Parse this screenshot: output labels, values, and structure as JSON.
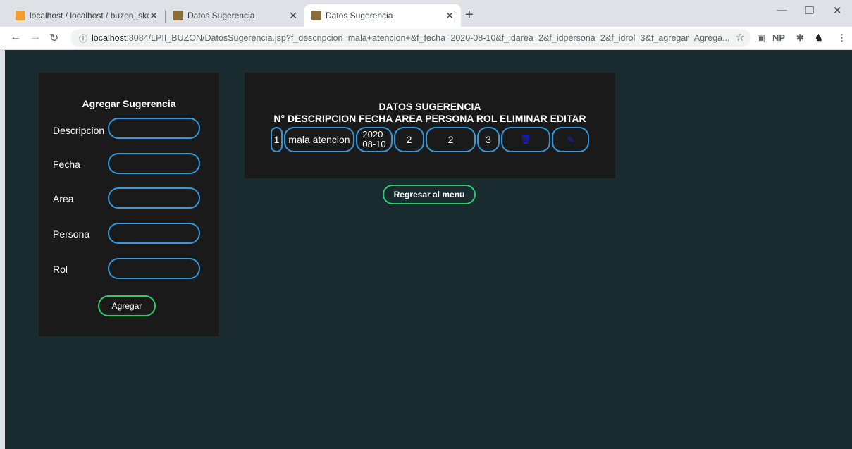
{
  "browser": {
    "tabs": [
      {
        "title": "localhost / localhost / buzon_ske",
        "active": false
      },
      {
        "title": "Datos Sugerencia",
        "active": false
      },
      {
        "title": "Datos Sugerencia",
        "active": true
      }
    ],
    "url_host": "localhost",
    "url_rest": ":8084/LPII_BUZON/DatosSugerencia.jsp?f_descripcion=mala+atencion+&f_fecha=2020-08-10&f_idarea=2&f_idpersona=2&f_idrol=3&f_agregar=Agrega...",
    "ext_np": "NP"
  },
  "form": {
    "title": "Agregar Sugerencia",
    "fields": [
      {
        "label": "Descripcion",
        "value": ""
      },
      {
        "label": "Fecha",
        "value": ""
      },
      {
        "label": "Area",
        "value": ""
      },
      {
        "label": "Persona",
        "value": ""
      },
      {
        "label": "Rol",
        "value": ""
      }
    ],
    "submit_label": "Agregar"
  },
  "table": {
    "title": "DATOS SUGERENCIA",
    "headers": [
      "N°",
      "DESCRIPCION",
      "FECHA",
      "AREA",
      "PERSONA",
      "ROL",
      "ELIMINAR",
      "EDITAR"
    ],
    "row": {
      "n": "1",
      "descripcion": "mala atencion",
      "fecha_a": "2020-",
      "fecha_b": "08-10",
      "area": "2",
      "persona": "2",
      "rol": "3"
    }
  },
  "back_label": "Regresar al menu",
  "colors": {
    "page_bg": "#1a2b30",
    "panel_bg": "#1a1a1a",
    "input_border": "#3498db",
    "button_border": "#2ecc71",
    "icon_color": "#1a1aff"
  }
}
